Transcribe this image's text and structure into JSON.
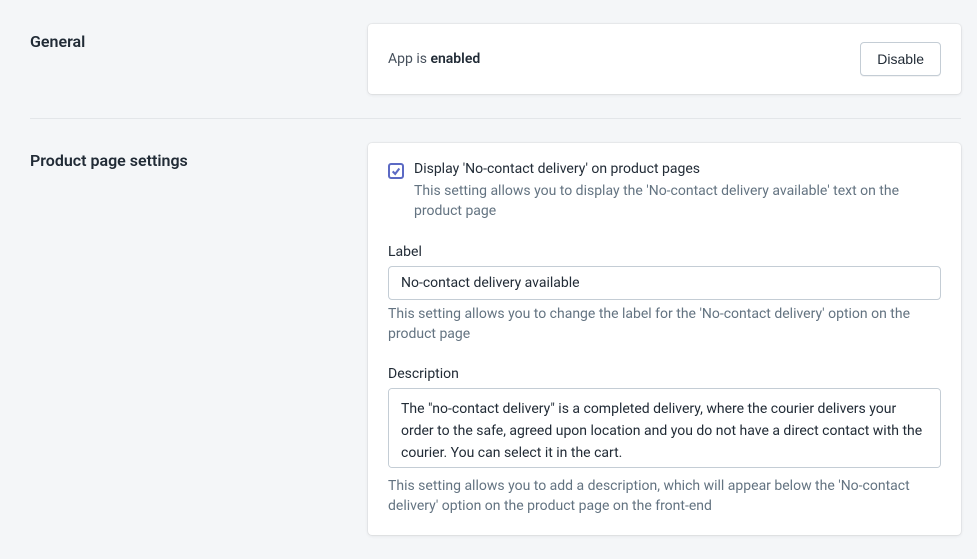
{
  "general": {
    "title": "General",
    "status_prefix": "App is ",
    "status_bold": "enabled",
    "disable_btn": "Disable"
  },
  "product_page": {
    "title": "Product page settings",
    "display_checkbox_label": "Display 'No-contact delivery' on product pages",
    "display_checkbox_help": "This setting allows you to display the 'No-contact delivery available' text on the product page",
    "label_field": {
      "label": "Label",
      "value": "No-contact delivery available",
      "help": "This setting allows you to change the label for the 'No-contact delivery' option on the product page"
    },
    "description_field": {
      "label": "Description",
      "value": "The \"no-contact delivery\" is a completed delivery, where the courier delivers your order to the safe, agreed upon location and you do not have a direct contact with the courier. You can select it in the cart.",
      "help": "This setting allows you to add a description, which will appear below the 'No-contact delivery' option on the product page on the front-end"
    }
  }
}
